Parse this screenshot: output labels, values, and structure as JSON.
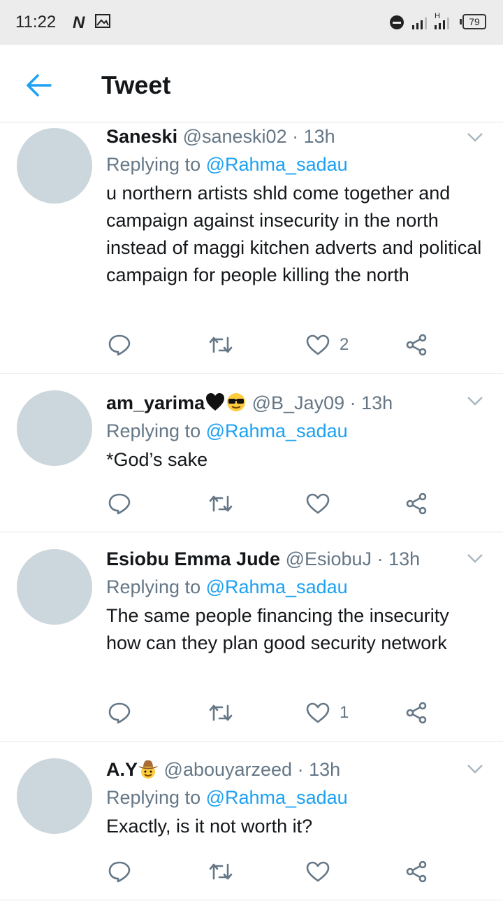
{
  "status": {
    "time": "11:22",
    "n_icon": "N",
    "battery": "79"
  },
  "appbar": {
    "title": "Tweet"
  },
  "tweets": [
    {
      "name": "Saneski",
      "handle": "@saneski02",
      "time": "13h",
      "replying_label": "Replying to",
      "replying_to": "@Rahma_sadau",
      "text": "u northern artists shld come together and campaign against insecurity in the north instead of maggi kitchen adverts and political campaign for people killing the north",
      "likes": "2"
    },
    {
      "name": "am_yarima",
      "handle": "@B_Jay09",
      "time": "13h",
      "replying_label": "Replying to",
      "replying_to": "@Rahma_sadau",
      "text": "*God’s sake",
      "likes": ""
    },
    {
      "name": "Esiobu Emma Jude",
      "handle": "@EsiobuJ",
      "time": "13h",
      "replying_label": "Replying to",
      "replying_to": "@Rahma_sadau",
      "text": "The same people financing the insecurity how can they plan good security network",
      "likes": "1"
    },
    {
      "name": "A.Y",
      "handle": "@abouyarzeed",
      "time": "13h",
      "replying_label": "Replying to",
      "replying_to": "@Rahma_sadau",
      "text": "Exactly, is it not worth it?",
      "likes": ""
    }
  ],
  "icons": {
    "reply": "reply-icon",
    "retweet": "retweet-icon",
    "like": "heart-icon",
    "share": "share-icon",
    "caret": "chevron-down-icon",
    "back": "back-arrow-icon"
  },
  "colors": {
    "accent": "#1da1f2",
    "secondary_text": "#657786",
    "avatar": "#ccd6dd"
  }
}
